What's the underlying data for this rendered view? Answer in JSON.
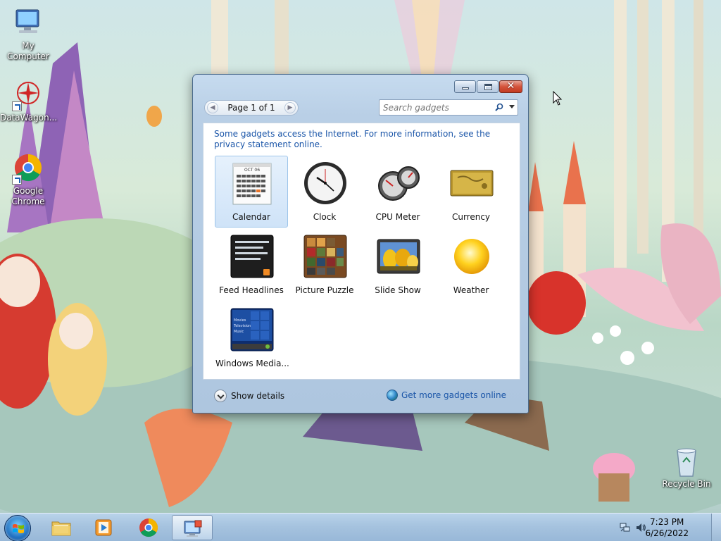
{
  "desktop": {
    "icons": [
      {
        "label": "My Computer"
      },
      {
        "label": "DataWagon..."
      },
      {
        "label": "Google Chrome"
      },
      {
        "label": "Recycle Bin"
      }
    ]
  },
  "window": {
    "pager_label": "Page 1 of 1",
    "search_placeholder": "Search gadgets",
    "notice": "Some gadgets access the Internet.  For more information, see the privacy statement online.",
    "gadgets": [
      {
        "label": "Calendar",
        "icon": "calendar-icon",
        "selected": true
      },
      {
        "label": "Clock",
        "icon": "clock-icon"
      },
      {
        "label": "CPU Meter",
        "icon": "cpu-meter-icon"
      },
      {
        "label": "Currency",
        "icon": "currency-icon"
      },
      {
        "label": "Feed Headlines",
        "icon": "feed-headlines-icon"
      },
      {
        "label": "Picture Puzzle",
        "icon": "picture-puzzle-icon"
      },
      {
        "label": "Slide Show",
        "icon": "slide-show-icon"
      },
      {
        "label": "Weather",
        "icon": "weather-icon"
      },
      {
        "label": "Windows Media...",
        "icon": "windows-media-icon"
      }
    ],
    "calendar_month": "OCT 06",
    "media_lines": [
      "Movies",
      "Television",
      "Music"
    ],
    "show_details": "Show details",
    "get_more": "Get more gadgets online"
  },
  "taskbar": {
    "items": [
      {
        "name": "file-explorer"
      },
      {
        "name": "media-player"
      },
      {
        "name": "chrome"
      },
      {
        "name": "gadget-gallery",
        "active": true
      }
    ],
    "clock_time": "7:23 PM",
    "clock_date": "6/26/2022"
  },
  "colors": {
    "link": "#1a55a8",
    "selection": "#cfe3f8",
    "taskbar": "#a6c3df"
  }
}
